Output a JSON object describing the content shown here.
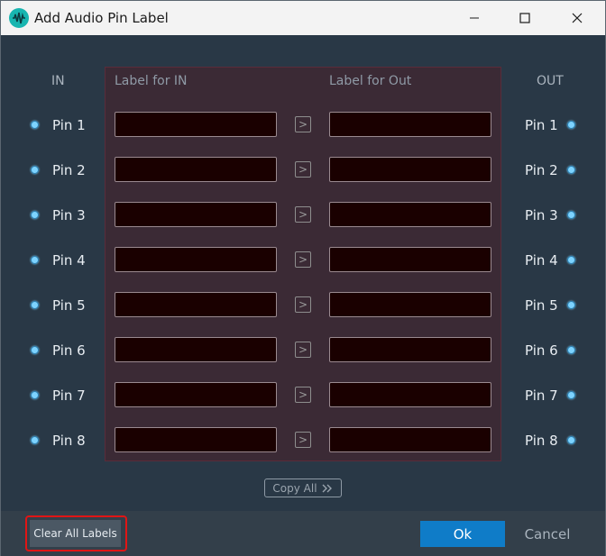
{
  "window": {
    "title": "Add Audio Pin Label",
    "minimize_icon": "minimize-icon",
    "maximize_icon": "maximize-icon",
    "close_icon": "close-icon"
  },
  "columns": {
    "in": "IN",
    "label_in": "Label for IN",
    "label_out": "Label for Out",
    "out": "OUT"
  },
  "pins": [
    {
      "in": "Pin 1",
      "out": "Pin 1",
      "label_in": "",
      "label_out": ""
    },
    {
      "in": "Pin 2",
      "out": "Pin 2",
      "label_in": "",
      "label_out": ""
    },
    {
      "in": "Pin 3",
      "out": "Pin 3",
      "label_in": "",
      "label_out": ""
    },
    {
      "in": "Pin 4",
      "out": "Pin 4",
      "label_in": "",
      "label_out": ""
    },
    {
      "in": "Pin 5",
      "out": "Pin 5",
      "label_in": "",
      "label_out": ""
    },
    {
      "in": "Pin 6",
      "out": "Pin 6",
      "label_in": "",
      "label_out": ""
    },
    {
      "in": "Pin 7",
      "out": "Pin 7",
      "label_in": "",
      "label_out": ""
    },
    {
      "in": "Pin 8",
      "out": "Pin 8",
      "label_in": "",
      "label_out": ""
    }
  ],
  "copy_all": {
    "label": "Copy All",
    "icon": "double-chevron-right-icon"
  },
  "footer": {
    "clear_all": "Clear All Labels",
    "ok": "Ok",
    "cancel": "Cancel"
  },
  "colors": {
    "accent": "#0f7cc8",
    "highlight": "#e01515",
    "pin_dot": "#7dd3ff",
    "panel": "#3b2a35",
    "field": "#1a0000"
  }
}
